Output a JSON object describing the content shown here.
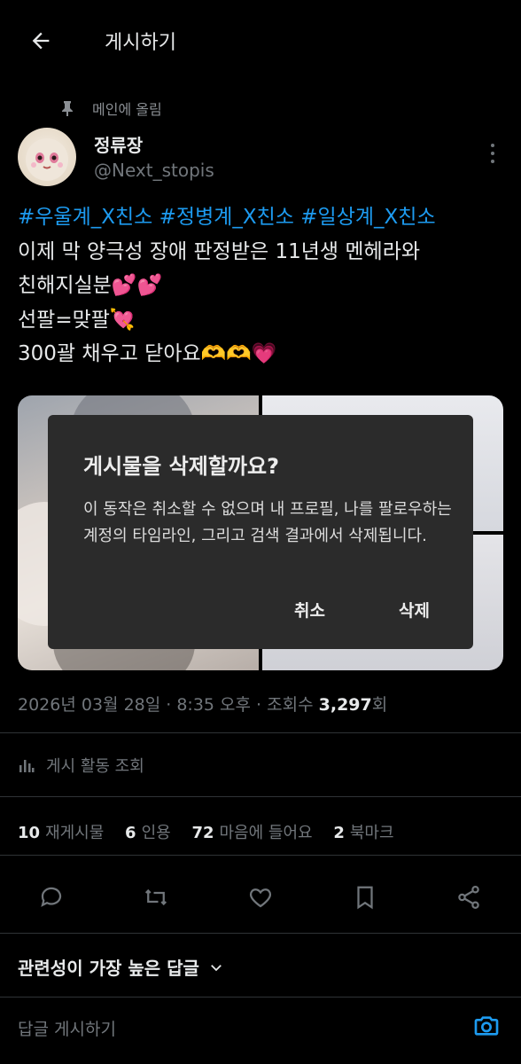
{
  "header": {
    "title": "게시하기",
    "back_icon": "arrow-left-icon"
  },
  "pinned": {
    "label": "메인에 올림",
    "icon": "pin-icon"
  },
  "user": {
    "name": "정류장",
    "handle": "@Next_stopis"
  },
  "tweet": {
    "hashtags": [
      "#우울계_X친소",
      "#정병계_X친소",
      "#일상계_X친소"
    ],
    "lines": [
      "이제 막 양극성 장애 판정받은 11년생 멘헤라와",
      "친해지실분💕💕",
      "선팔=맞팔💘",
      "300괄 채우고 닫아요🫶🫶💗"
    ]
  },
  "dialog": {
    "title": "게시물을 삭제할까요?",
    "body": "이 동작은 취소할 수 없으며 내 프로필, 나를 팔로우하는 계정의 타임라인, 그리고 검색 결과에서 삭제됩니다.",
    "cancel_label": "취소",
    "delete_label": "삭제"
  },
  "meta": {
    "datetime": "2026년 03월 28일 · 8:35 오후 · 조회수 ",
    "views": "3,297",
    "views_suffix": "회"
  },
  "activity": {
    "label": "게시 활동 조회"
  },
  "stats": [
    {
      "count": "10",
      "label": "재게시물"
    },
    {
      "count": "6",
      "label": "인용"
    },
    {
      "count": "72",
      "label": "마음에 들어요"
    },
    {
      "count": "2",
      "label": "북마크"
    }
  ],
  "replies": {
    "sort_label": "관련성이 가장 높은 답글"
  },
  "reply_input": {
    "placeholder": "답글 게시하기"
  },
  "colors": {
    "accent": "#1d9bf0",
    "muted": "#71767b",
    "dialog_bg": "#2b2b2b"
  }
}
